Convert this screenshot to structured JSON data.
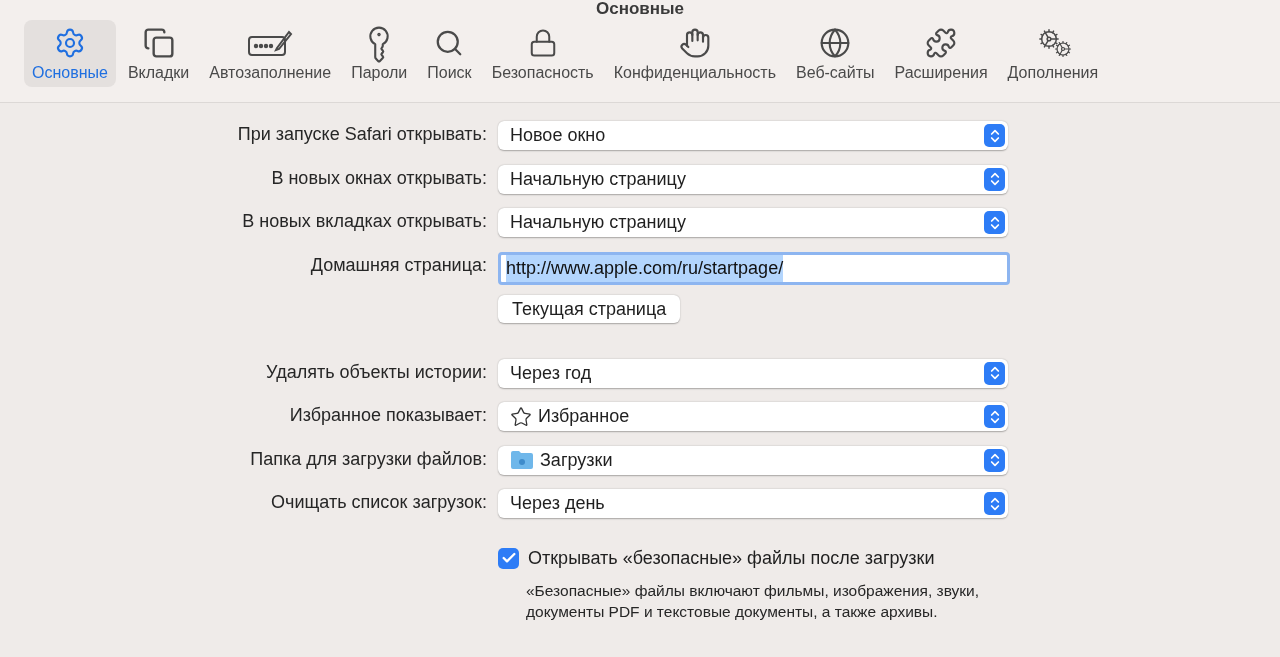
{
  "window": {
    "title": "Основные"
  },
  "tabs": [
    {
      "label": "Основные",
      "selected": true
    },
    {
      "label": "Вкладки",
      "selected": false
    },
    {
      "label": "Автозаполнение",
      "selected": false
    },
    {
      "label": "Пароли",
      "selected": false
    },
    {
      "label": "Поиск",
      "selected": false
    },
    {
      "label": "Безопасность",
      "selected": false
    },
    {
      "label": "Конфиденциальность",
      "selected": false
    },
    {
      "label": "Веб-сайты",
      "selected": false
    },
    {
      "label": "Расширения",
      "selected": false
    },
    {
      "label": "Дополнения",
      "selected": false
    }
  ],
  "settings": [
    {
      "kind": "popup",
      "label": "При запуске Safari открывать:",
      "value": "Новое окно"
    },
    {
      "kind": "popup",
      "label": "В новых окнах открывать:",
      "value": "Начальную страницу"
    },
    {
      "kind": "popup",
      "label": "В новых вкладках открывать:",
      "value": "Начальную страницу"
    },
    {
      "kind": "field",
      "label": "Домашняя страница:",
      "value": "http://www.apple.com/ru/startpage/",
      "focused": true,
      "selected": true
    },
    {
      "kind": "button",
      "value": "Текущая страница"
    },
    {
      "kind": "spacer"
    },
    {
      "kind": "popup",
      "label": "Удалять объекты истории:",
      "value": "Через год"
    },
    {
      "kind": "starpopup",
      "label": "Избранное показывает:",
      "value": "Избранное"
    },
    {
      "kind": "folderpopup",
      "label": "Папка для загрузки файлов:",
      "value": "Загрузки"
    },
    {
      "kind": "popup",
      "label": "Очищать список загрузок:",
      "value": "Через день"
    },
    {
      "kind": "checkbox",
      "value": "Открывать «безопасные» файлы после загрузки",
      "checked": true,
      "note": "«Безопасные» файлы включают фильмы, изображения, звуки, документы PDF и текстовые документы, а также архивы."
    }
  ]
}
